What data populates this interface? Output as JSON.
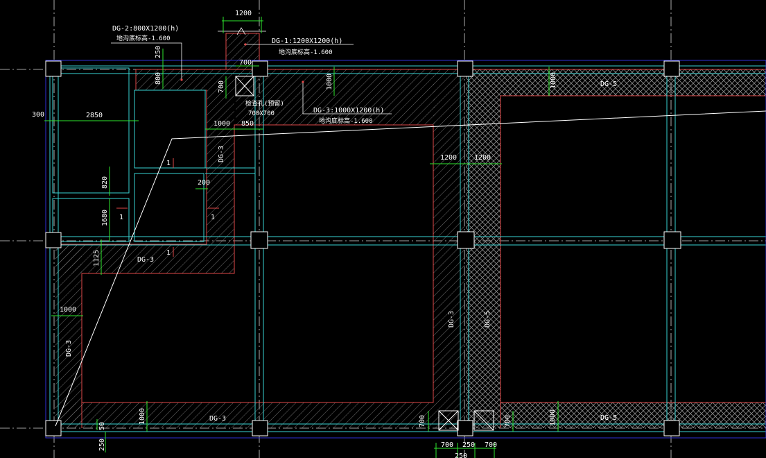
{
  "colors": {
    "background": "#000000",
    "axis_line": "#1f2fd6",
    "grid_line": "#c8c8c8",
    "beam_cyan": "#39d4d4",
    "foundation_red": "#e04848",
    "dimension_green": "#2ee82e",
    "text_white": "#ffffff",
    "hatch": "#9a9a9a"
  },
  "icons": [
    "elevator-pit-cross-icon",
    "pile-cap-icon",
    "section-mark-icon"
  ],
  "dimensions": {
    "d1200_top": "1200",
    "d250_top": "250",
    "d800": "800",
    "d700_top": "700",
    "d700_left": "700",
    "d1000_a": "1000",
    "d1000_b": "1000",
    "d300": "300",
    "d2850": "2850",
    "d1000_c": "1000",
    "d850": "850",
    "d820": "820",
    "d1680": "1680",
    "d200": "200",
    "d1125": "1125",
    "d1200_mid": "1200",
    "d1200_mid2": "1200",
    "d1000_left": "1000",
    "d1000_bottom": "1000",
    "d50": "50",
    "d250_bottom": "250",
    "d700_bot_a": "700",
    "d700_bot_b": "700",
    "d1000_bot_r": "1000",
    "d700_b1": "700",
    "d250_b1": "250",
    "d700_b2": "700",
    "d250_b2": "250"
  },
  "labels": {
    "dg2_spec": "DG-2:800X1200(h)",
    "dg2_elev": "地沟底标高-1.600",
    "dg1_spec": "DG-1:1200X1200(h)",
    "dg1_elev": "地沟底标高-1.600",
    "dg3_spec": "DG-3:1000X1200(h)",
    "dg3_elev": "地沟底标高-1.600",
    "pit_name": "检查孔(预留)",
    "pit_size": "700X700",
    "dg3_a": "DG-3",
    "dg3_b": "DG-3",
    "dg3_c": "DG-3",
    "dg3_d": "DG-3",
    "dg3_e": "DG-3",
    "dg5_a": "DG-5",
    "dg5_b": "DG-5",
    "dg5_c": "DG-5",
    "sec1_a": "1",
    "sec1_b": "1",
    "sec1_c": "1",
    "sec1_d": "1"
  }
}
